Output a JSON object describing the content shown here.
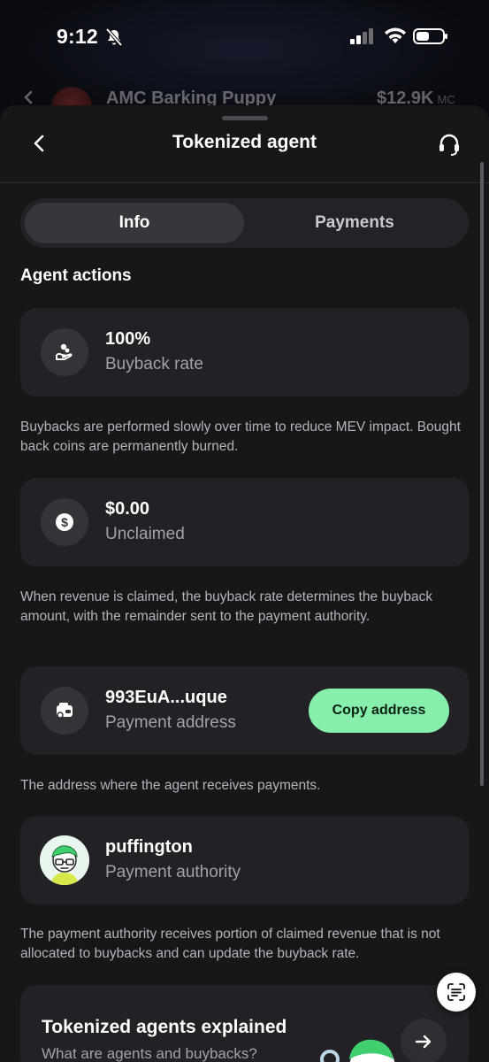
{
  "status_bar": {
    "time": "9:12"
  },
  "background_row": {
    "coin_name": "AMC Barking Puppy",
    "market_cap": "$12.9K",
    "market_cap_suffix": "MC"
  },
  "nav": {
    "title": "Tokenized agent"
  },
  "tabs": [
    {
      "label": "Info",
      "selected": true
    },
    {
      "label": "Payments",
      "selected": false
    }
  ],
  "section_title": "Agent actions",
  "cards": {
    "buyback": {
      "value": "100%",
      "label": "Buyback rate",
      "icon": "hand-coins-icon"
    },
    "unclaimed": {
      "value": "$0.00",
      "label": "Unclaimed",
      "icon": "dollar-coin-icon"
    },
    "payment_address": {
      "value": "993EuA...uque",
      "label": "Payment address",
      "button": "Copy address",
      "icon": "wallet-icon"
    },
    "authority": {
      "value": "puffington",
      "label": "Payment authority",
      "icon": "user-avatar"
    }
  },
  "notes": {
    "buyback": "Buybacks are performed slowly over time to reduce MEV impact. Bought back coins are permanently burned.",
    "unclaimed": "When revenue is claimed, the buyback rate determines the buyback amount, with the remainder sent to the payment authority.",
    "address": "The address where the agent receives payments.",
    "authority": "The payment authority receives portion of claimed revenue that is not allocated to buybacks and can update the buyback rate."
  },
  "explainer": {
    "title": "Tokenized agents explained",
    "subtitle": "What are agents and buybacks?"
  },
  "colors": {
    "accent_green": "#86efac",
    "card_bg": "#222226",
    "sheet_bg": "#17171a"
  }
}
